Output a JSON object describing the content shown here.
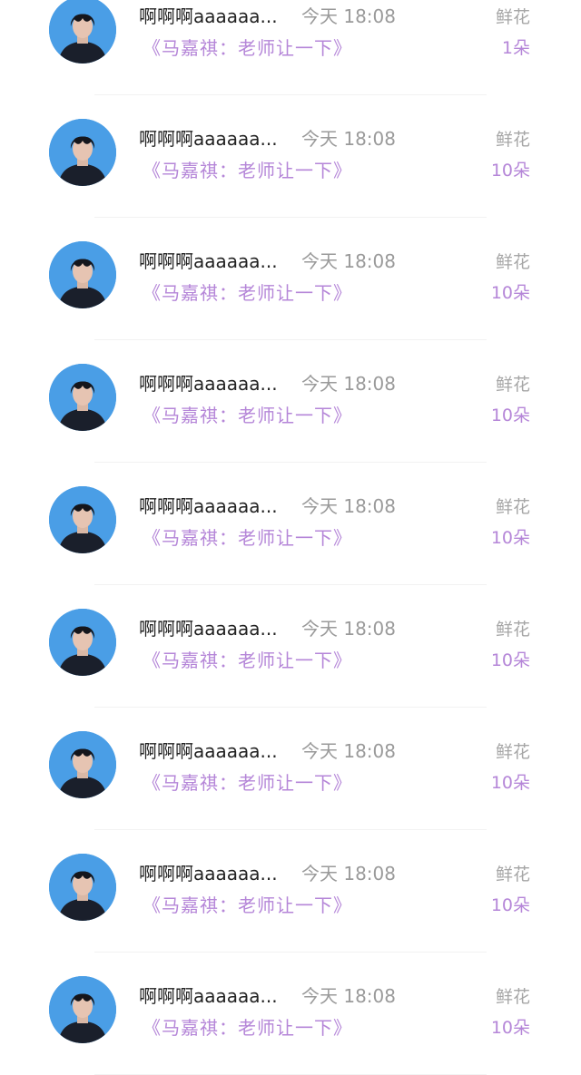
{
  "rows": [
    {
      "name": "啊啊啊aaaaaa...",
      "time": "今天 18:08",
      "book": "《马嘉祺：老师让一下》",
      "gift_label": "鲜花",
      "gift_count": "1朵"
    },
    {
      "name": "啊啊啊aaaaaa...",
      "time": "今天 18:08",
      "book": "《马嘉祺：老师让一下》",
      "gift_label": "鲜花",
      "gift_count": "10朵"
    },
    {
      "name": "啊啊啊aaaaaa...",
      "time": "今天 18:08",
      "book": "《马嘉祺：老师让一下》",
      "gift_label": "鲜花",
      "gift_count": "10朵"
    },
    {
      "name": "啊啊啊aaaaaa...",
      "time": "今天 18:08",
      "book": "《马嘉祺：老师让一下》",
      "gift_label": "鲜花",
      "gift_count": "10朵"
    },
    {
      "name": "啊啊啊aaaaaa...",
      "time": "今天 18:08",
      "book": "《马嘉祺：老师让一下》",
      "gift_label": "鲜花",
      "gift_count": "10朵"
    },
    {
      "name": "啊啊啊aaaaaa...",
      "time": "今天 18:08",
      "book": "《马嘉祺：老师让一下》",
      "gift_label": "鲜花",
      "gift_count": "10朵"
    },
    {
      "name": "啊啊啊aaaaaa...",
      "time": "今天 18:08",
      "book": "《马嘉祺：老师让一下》",
      "gift_label": "鲜花",
      "gift_count": "10朵"
    },
    {
      "name": "啊啊啊aaaaaa...",
      "time": "今天 18:08",
      "book": "《马嘉祺：老师让一下》",
      "gift_label": "鲜花",
      "gift_count": "10朵"
    },
    {
      "name": "啊啊啊aaaaaa...",
      "time": "今天 18:08",
      "book": "《马嘉祺：老师让一下》",
      "gift_label": "鲜花",
      "gift_count": "10朵"
    }
  ],
  "colors": {
    "accent": "#b586d8",
    "muted": "#9a9a9a",
    "avatar_bg": "#4a9ee6"
  }
}
